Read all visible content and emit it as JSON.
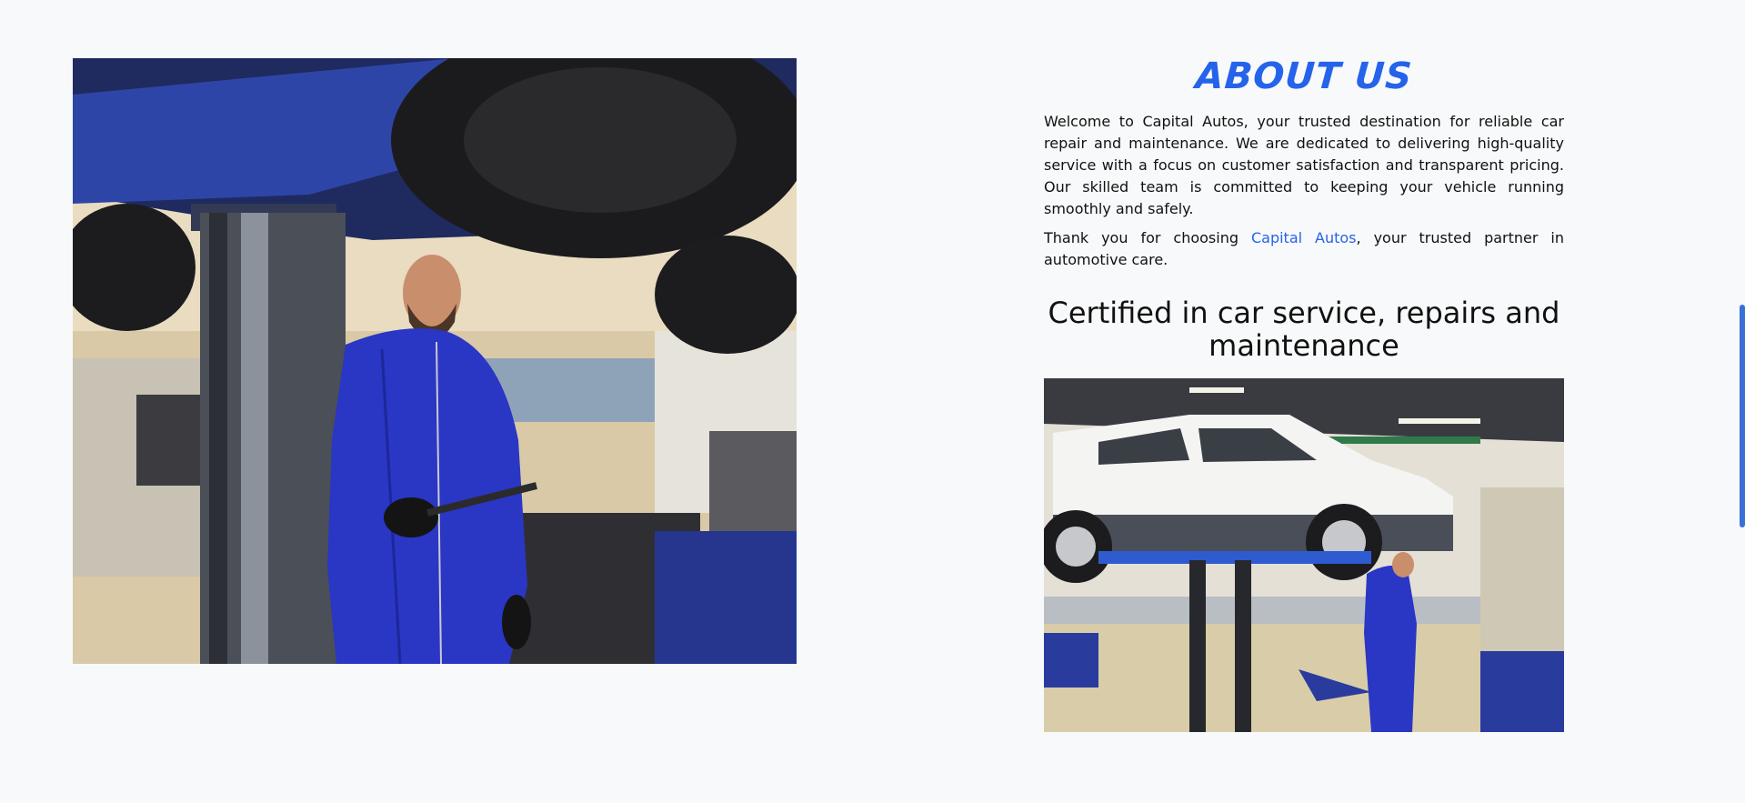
{
  "about": {
    "title": "ABOUT US",
    "paragraph1": "Welcome to Capital Autos, your trusted destination for reliable car repair and maintenance. We are dedicated to delivering high-quality service with a focus on customer satisfaction and transparent pricing. Our skilled team is committed to keeping your vehicle running smoothly and safely.",
    "paragraph2_before": "Thank you for choosing ",
    "paragraph2_link": "Capital Autos",
    "paragraph2_after": ", your trusted partner in automotive care.",
    "cert_heading": "Certified in car service, repairs and maintenance"
  },
  "images": {
    "left_photo": "mechanic-under-car-photo",
    "right_photo": "car-on-lift-photo"
  },
  "colors": {
    "accent": "#2563eb",
    "background": "#f8f9fa",
    "text": "#111111"
  }
}
